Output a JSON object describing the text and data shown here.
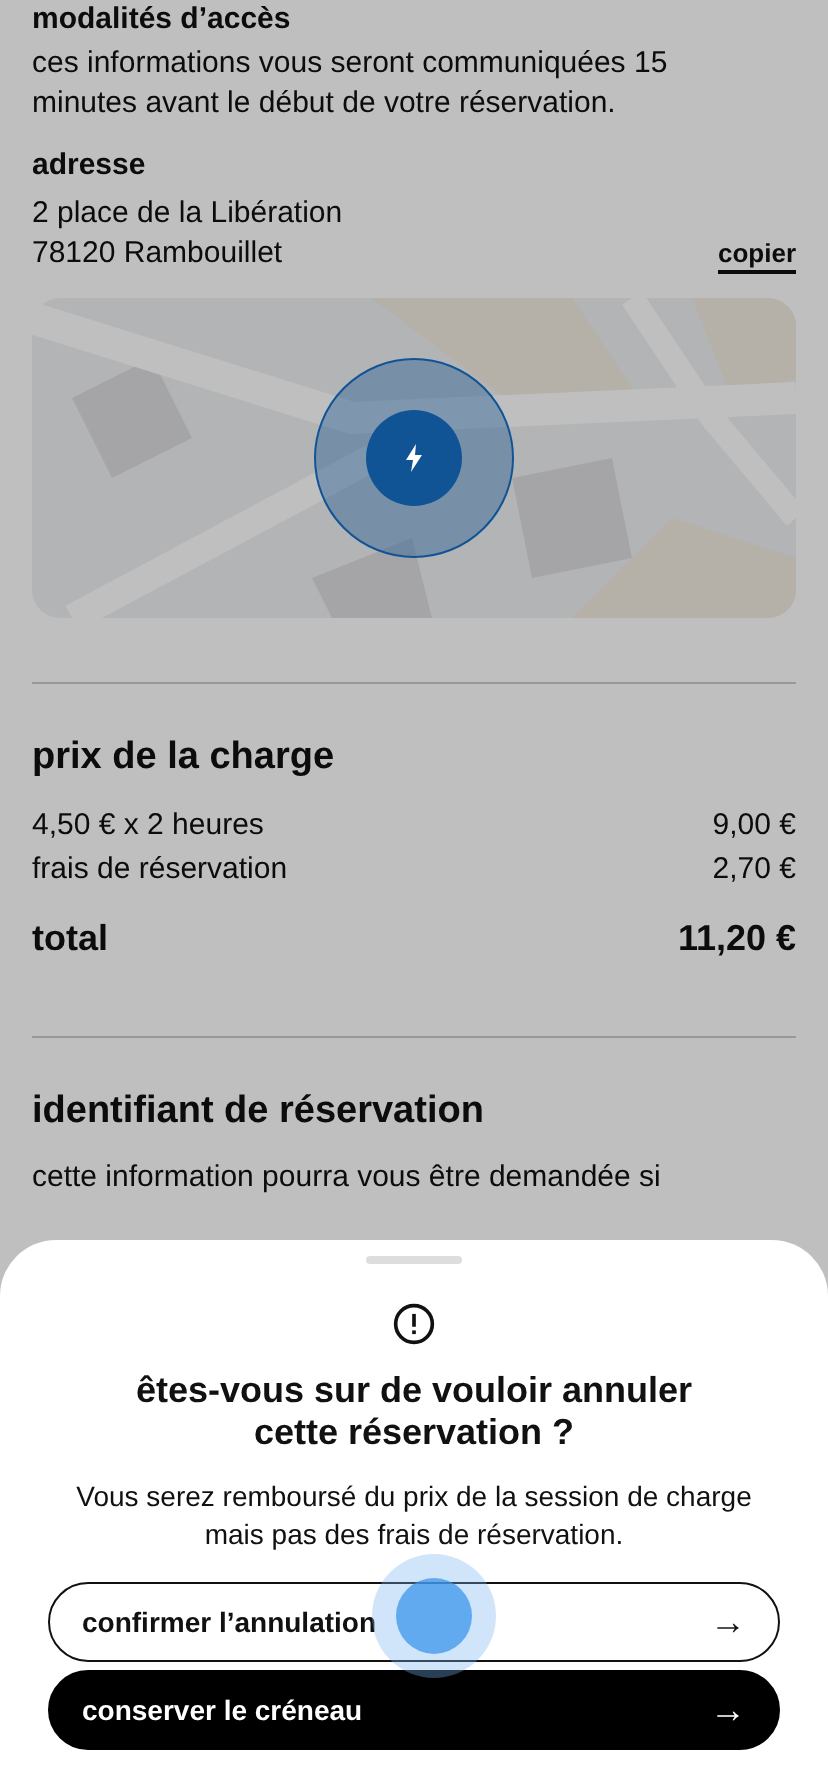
{
  "access": {
    "title": "modalités d’accès",
    "text": "ces informations vous seront communiquées 15 minutes avant le début de votre réservation."
  },
  "address": {
    "title": "adresse",
    "lines": [
      "2 place de la Libération",
      "78120 Rambouillet"
    ],
    "copy_label": "copier"
  },
  "price": {
    "title": "prix de la charge",
    "rows": [
      {
        "label": "4,50 € x 2 heures",
        "amount": "9,00 €"
      },
      {
        "label": "frais de réservation",
        "amount": "2,70 €"
      }
    ],
    "total_label": "total",
    "total_amount": "11,20 €"
  },
  "booking_id": {
    "title": "identifiant de réservation",
    "text": "cette information pourra vous être demandée si"
  },
  "dialog": {
    "title": "êtes-vous sur de vouloir annuler cette réservation ?",
    "text": "Vous serez remboursé du prix de la session de charge mais pas des frais de réservation.",
    "buttons": [
      {
        "label": "confirmer l’annulation",
        "kind": "outline",
        "arrow": "→"
      },
      {
        "label": "conserver le créneau",
        "kind": "filled",
        "arrow": "→"
      }
    ]
  }
}
